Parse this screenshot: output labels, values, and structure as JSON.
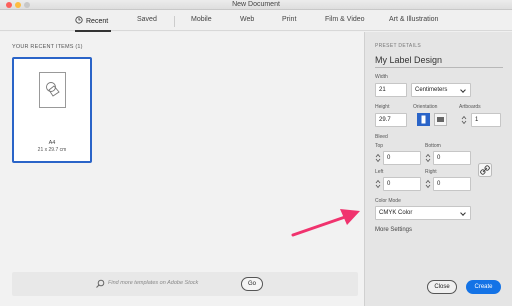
{
  "window": {
    "title": "New Document"
  },
  "tabs": [
    {
      "label": "Recent",
      "active": true,
      "icon": "clock-icon"
    },
    {
      "label": "Saved"
    },
    {
      "label": "Mobile"
    },
    {
      "label": "Web"
    },
    {
      "label": "Print"
    },
    {
      "label": "Film & Video"
    },
    {
      "label": "Art & Illustration"
    }
  ],
  "recent": {
    "heading": "YOUR RECENT ITEMS  (1)",
    "items": [
      {
        "name": "A4",
        "size": "21 x 29.7 cm",
        "icon": "document-shapes-icon"
      }
    ]
  },
  "search": {
    "placeholder": "Find more templates on Adobe Stock",
    "go_label": "Go"
  },
  "preset": {
    "heading": "PRESET DETAILS",
    "name": "My Label Design",
    "width_label": "Width",
    "width_value": "21",
    "units": "Centimeters",
    "height_label": "Height",
    "height_value": "29.7",
    "orientation_label": "Orientation",
    "orientation_selected": "portrait",
    "artboards_label": "Artboards",
    "artboards_value": "1",
    "bleed_label": "Bleed",
    "bleed_top_label": "Top",
    "bleed_top": "0",
    "bleed_bottom_label": "Bottom",
    "bleed_bottom": "0",
    "bleed_left_label": "Left",
    "bleed_left": "0",
    "bleed_right_label": "Right",
    "bleed_right": "0",
    "color_mode_label": "Color Mode",
    "color_mode": "CMYK Color",
    "more_settings": "More Settings"
  },
  "actions": {
    "close_label": "Close",
    "create_label": "Create"
  },
  "colors": {
    "accent": "#1473e6",
    "selection": "#2a64c8",
    "annotation_arrow": "#f0336e"
  }
}
